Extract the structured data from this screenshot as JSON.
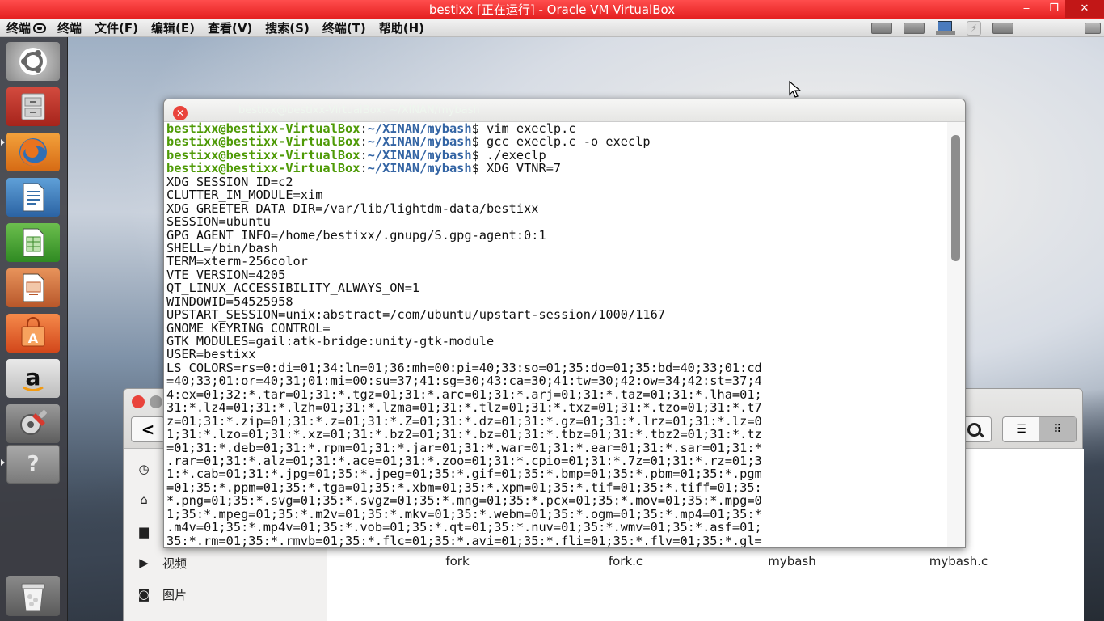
{
  "window": {
    "title": "bestixx [正在运行] - Oracle VM VirtualBox",
    "close_glyph": "✕",
    "max_glyph": "❐",
    "min_glyph": "‒"
  },
  "menubar": {
    "host_label": "终端",
    "items": [
      "终端",
      "文件(F)",
      "编辑(E)",
      "查看(V)",
      "搜索(S)",
      "终端(T)",
      "帮助(H)"
    ]
  },
  "launcher": {
    "help_glyph": "?"
  },
  "terminal": {
    "title": "bestixx@bestixx-VirtualBox: ~/XINAN/mybash",
    "close_glyph": "✕",
    "prompt_user": "bestixx@bestixx-VirtualBox",
    "prompt_sep": ":",
    "prompt_path": "~/XINAN/mybash",
    "commands": [
      "$ vim execlp.c",
      "$ gcc execlp.c -o execlp",
      "$ ./execlp",
      "$ XDG_VTNR=7"
    ],
    "output": [
      "XDG_SESSION_ID=c2",
      "CLUTTER_IM_MODULE=xim",
      "XDG_GREETER_DATA_DIR=/var/lib/lightdm-data/bestixx",
      "SESSION=ubuntu",
      "GPG_AGENT_INFO=/home/bestixx/.gnupg/S.gpg-agent:0:1",
      "SHELL=/bin/bash",
      "TERM=xterm-256color",
      "VTE_VERSION=4205",
      "QT_LINUX_ACCESSIBILITY_ALWAYS_ON=1",
      "WINDOWID=54525958",
      "UPSTART_SESSION=unix:abstract=/com/ubuntu/upstart-session/1000/1167",
      "GNOME_KEYRING_CONTROL=",
      "GTK_MODULES=gail:atk-bridge:unity-gtk-module",
      "USER=bestixx",
      "LS_COLORS=rs=0:di=01;34:ln=01;36:mh=00:pi=40;33:so=01;35:do=01;35:bd=40;33;01:cd",
      "=40;33;01:or=40;31;01:mi=00:su=37;41:sg=30;43:ca=30;41:tw=30;42:ow=34;42:st=37;4",
      "4:ex=01;32:*.tar=01;31:*.tgz=01;31:*.arc=01;31:*.arj=01;31:*.taz=01;31:*.lha=01;",
      "31:*.lz4=01;31:*.lzh=01;31:*.lzma=01;31:*.tlz=01;31:*.txz=01;31:*.tzo=01;31:*.t7",
      "z=01;31:*.zip=01;31:*.z=01;31:*.Z=01;31:*.dz=01;31:*.gz=01;31:*.lrz=01;31:*.lz=0",
      "1;31:*.lzo=01;31:*.xz=01;31:*.bz2=01;31:*.bz=01;31:*.tbz=01;31:*.tbz2=01;31:*.tz",
      "=01;31:*.deb=01;31:*.rpm=01;31:*.jar=01;31:*.war=01;31:*.ear=01;31:*.sar=01;31:*",
      ".rar=01;31:*.alz=01;31:*.ace=01;31:*.zoo=01;31:*.cpio=01;31:*.7z=01;31:*.rz=01;3",
      "1:*.cab=01;31:*.jpg=01;35:*.jpeg=01;35:*.gif=01;35:*.bmp=01;35:*.pbm=01;35:*.pgm",
      "=01;35:*.ppm=01;35:*.tga=01;35:*.xbm=01;35:*.xpm=01;35:*.tif=01;35:*.tiff=01;35:",
      "*.png=01;35:*.svg=01;35:*.svgz=01;35:*.mng=01;35:*.pcx=01;35:*.mov=01;35:*.mpg=0",
      "1;35:*.mpeg=01;35:*.m2v=01;35:*.mkv=01;35:*.webm=01;35:*.ogm=01;35:*.mp4=01;35:*",
      ".m4v=01;35:*.mp4v=01;35:*.vob=01;35:*.qt=01;35:*.nuv=01;35:*.wmv=01;35:*.asf=01;",
      "35:*.rm=01;35:*.rmvb=01;35:*.flc=01;35:*.avi=01;35:*.fli=01;35:*.flv=01;35:*.gl="
    ]
  },
  "filemanager": {
    "back_glyph": "<",
    "list_view_glyph": "☰",
    "grid_view_glyph": "⠿",
    "sidebar": [
      {
        "icon": "clock-icon",
        "glyph": "◷",
        "label": ""
      },
      {
        "icon": "home-icon",
        "glyph": "⌂",
        "label": ""
      },
      {
        "icon": "folder-icon",
        "glyph": "▆",
        "label": ""
      },
      {
        "icon": "video-icon",
        "glyph": "▶",
        "label": "视频"
      },
      {
        "icon": "camera-icon",
        "glyph": "◙",
        "label": "图片"
      }
    ],
    "files": [
      "fork",
      "fork.c",
      "mybash",
      "mybash.c"
    ]
  }
}
